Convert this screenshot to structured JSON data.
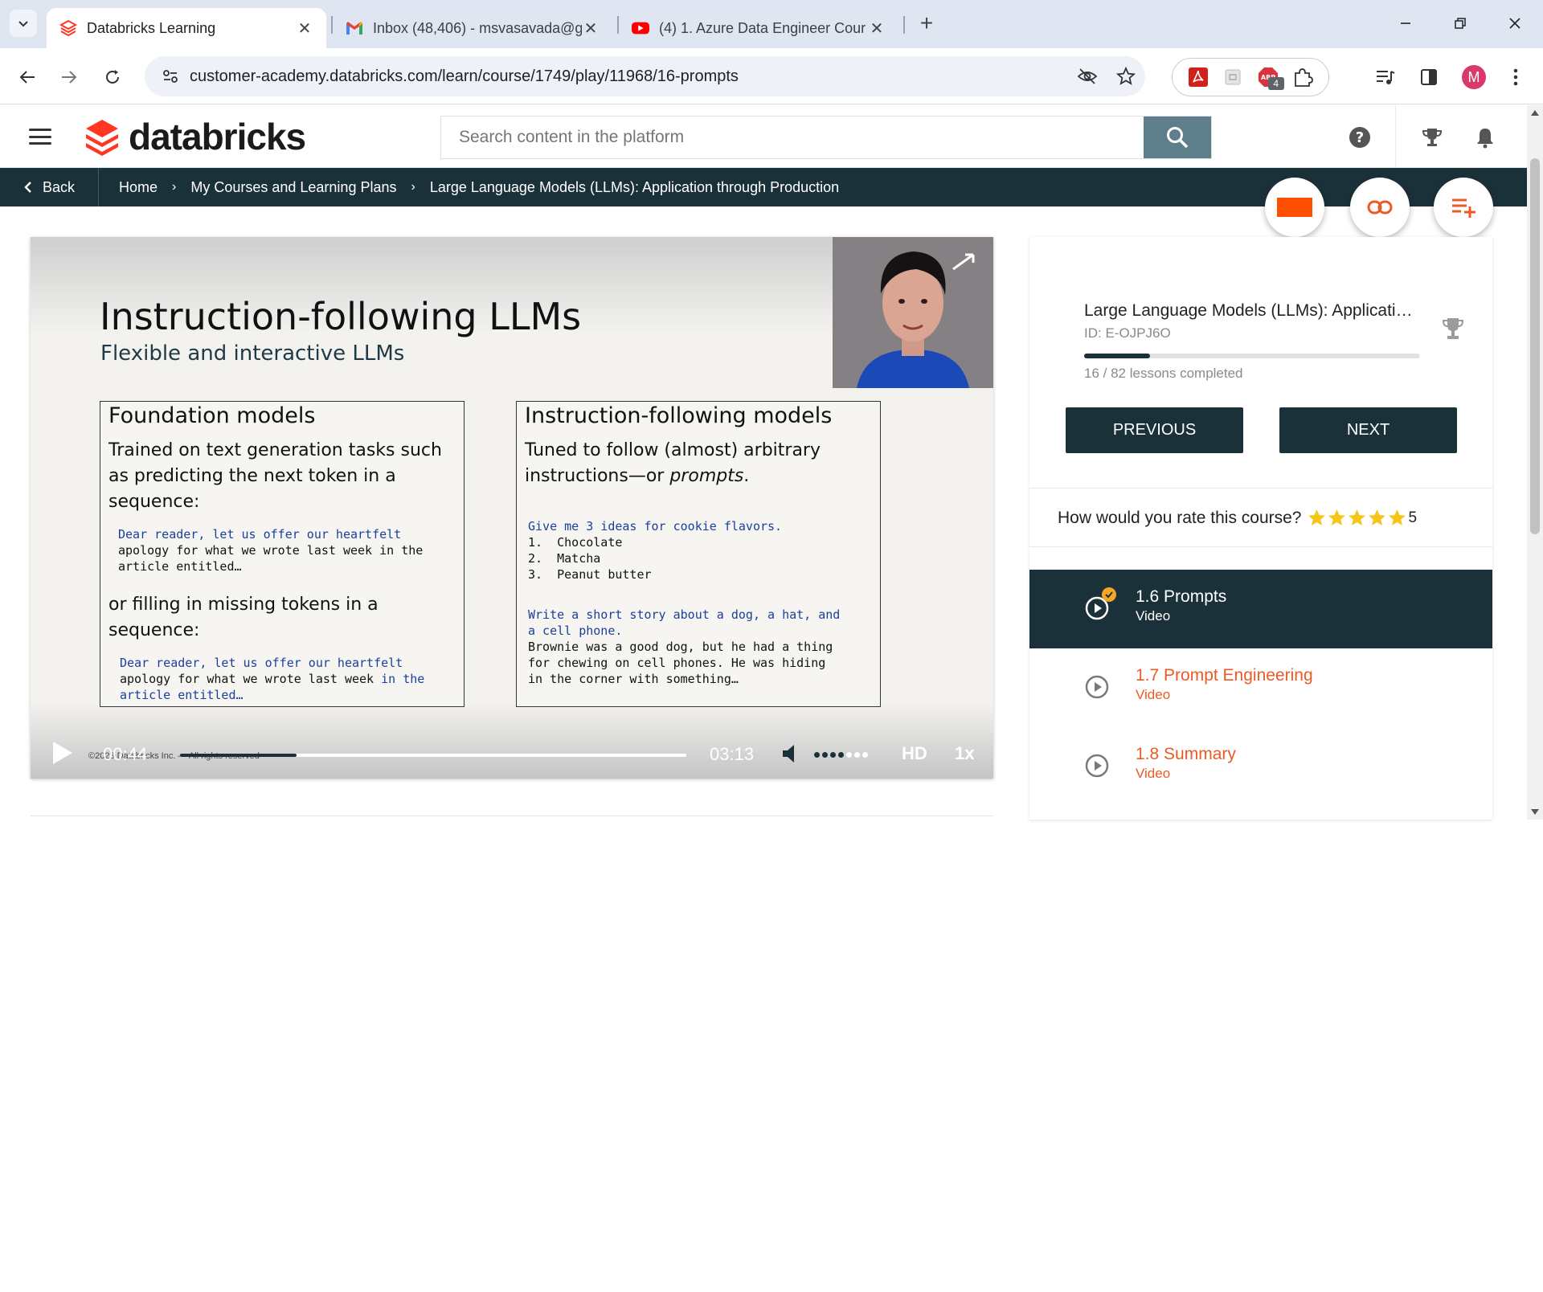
{
  "browser": {
    "tabs": [
      {
        "title": "Databricks Learning",
        "active": true
      },
      {
        "title": "Inbox (48,406) - msvasavada@g",
        "active": false
      },
      {
        "title": "(4) 1. Azure Data Engineer Cour",
        "active": false
      }
    ],
    "url": "customer-academy.databricks.com/learn/course/1749/play/11968/16-prompts",
    "extension_badge": "4",
    "profile_initial": "M",
    "ext_label": "ABP"
  },
  "header": {
    "logo_text": "databricks",
    "search_placeholder": "Search content in the platform",
    "brand_color": "#ff3621",
    "dark_color": "#1b3139"
  },
  "breadcrumb": {
    "back_label": "Back",
    "items": [
      "Home",
      "My Courses and Learning Plans",
      "Large Language Models (LLMs): Application through Production"
    ]
  },
  "video": {
    "slide_title": "Instruction-following LLMs",
    "slide_subtitle": "Flexible and interactive LLMs",
    "left_box": {
      "heading": "Foundation models",
      "text1": "Trained on text generation tasks such as predicting the next token in a sequence:",
      "code1_blue": "Dear reader, let us offer our heartfelt",
      "code1_rest": "apology for what we wrote last week in the\narticle entitled…",
      "text2": "or filling in missing tokens in a sequence:",
      "code2_line1": "Dear reader, let us offer our heartfelt",
      "code2_line2_black": "apology for what we wrote last week",
      "code2_line2_blue": " in the",
      "code2_line3": "article entitled…"
    },
    "right_box": {
      "heading": "Instruction-following models",
      "text_plain": "Tuned to follow (almost) arbitrary instructions—or ",
      "text_italic": "prompts",
      "text_end": ".",
      "prompt1": "Give me 3 ideas for cookie flavors.",
      "answer1": "1.  Chocolate\n2.  Matcha\n3.  Peanut butter",
      "prompt2": "Write a short story about a dog, a hat, and\na cell phone.",
      "answer2": "Brownie was a good dog, but he had a thing\nfor chewing on cell phones. He was hiding\nin the corner with something…"
    },
    "copyright": "©2023 Databricks Inc. — All rights reserved",
    "current_time": "00:44",
    "duration": "03:13",
    "progress_fraction": 0.23,
    "volume_level": 0.57,
    "quality": "HD",
    "speed": "1x"
  },
  "sidebar": {
    "course_title": "Large Language Models (LLMs): Applicati…",
    "course_id": "ID: E-OJPJ6O",
    "lessons_completed": "16 / 82 lessons completed",
    "progress_fraction": 0.195,
    "previous_label": "PREVIOUS",
    "next_label": "NEXT",
    "rating_prompt": "How would you rate this course?",
    "rating_value": "5",
    "star_color": "#f5c518",
    "lessons": [
      {
        "title": "1.6 Prompts",
        "kind": "Video",
        "current": true
      },
      {
        "title": "1.7 Prompt Engineering",
        "kind": "Video",
        "current": false
      },
      {
        "title": "1.8 Summary",
        "kind": "Video",
        "current": false
      }
    ],
    "lesson_link_color": "#eb5a25"
  }
}
